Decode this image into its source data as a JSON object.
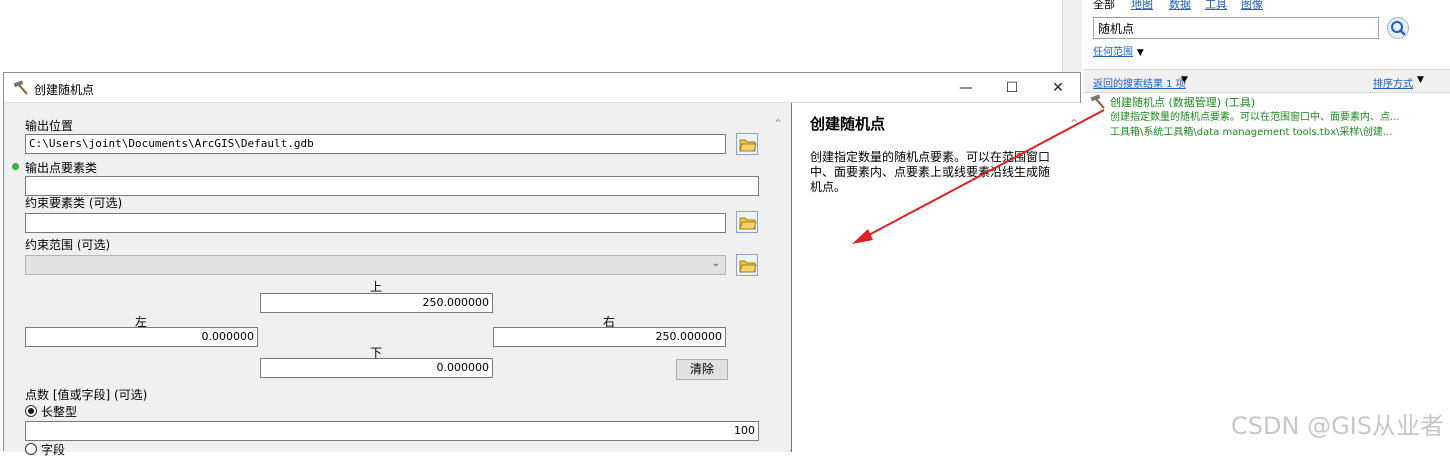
{
  "search": {
    "tabs": [
      "全部",
      "地图",
      "数据",
      "工具",
      "图像"
    ],
    "query": "随机点",
    "scope": "任何范围",
    "results_count": "返回的搜索结果 1 项",
    "sort": "排序方式",
    "result": {
      "title": "创建随机点 (数据管理) (工具)",
      "description": "创建指定数量的随机点要素。可以在范围窗口中、面要素内、点...",
      "path": "工具箱\\系统工具箱\\data management tools.tbx\\采样\\创建..."
    }
  },
  "dialog": {
    "title": "创建随机点",
    "output_location": {
      "label": "输出位置",
      "value": "C:\\Users\\joint\\Documents\\ArcGIS\\Default.gdb"
    },
    "output_fc": {
      "label": "输出点要素类",
      "value": ""
    },
    "constraint_fc": {
      "label": "约束要素类 (可选)",
      "value": ""
    },
    "constraint_extent": {
      "label": "约束范围 (可选)",
      "value": ""
    },
    "extent": {
      "top_label": "上",
      "top": "250.000000",
      "left_label": "左",
      "left": "0.000000",
      "right_label": "右",
      "right": "250.000000",
      "bottom_label": "下",
      "bottom": "0.000000",
      "clear": "清除"
    },
    "points": {
      "label": "点数 [值或字段] (可选)",
      "long_label": "长整型",
      "long_value": "100",
      "field_label": "字段"
    }
  },
  "help": {
    "title": "创建随机点",
    "body": "创建指定数量的随机点要素。可以在范围窗口中、面要素内、点要素上或线要素沿线生成随机点。"
  },
  "watermark": "CSDN @GIS从业者",
  "colors": {
    "link": "#1f5fbf",
    "result_text": "#1a8a1a",
    "arrow": "#e02020"
  }
}
